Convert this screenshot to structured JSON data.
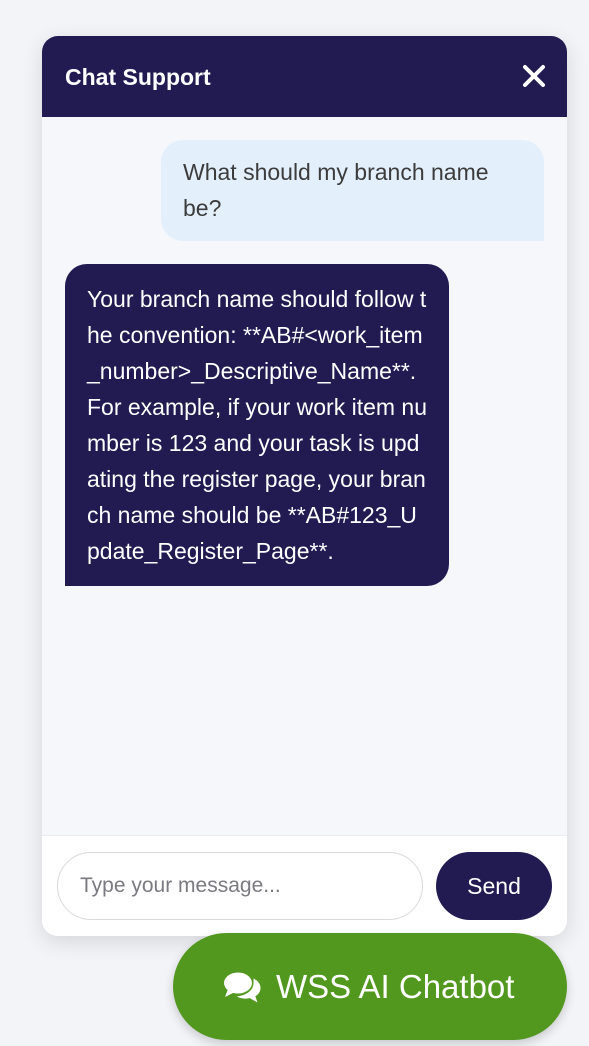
{
  "header": {
    "title": "Chat Support",
    "close_icon": "close-icon"
  },
  "messages": [
    {
      "role": "user",
      "text": "What should my branch name be?"
    },
    {
      "role": "bot",
      "text": "Your branch name should follow the convention: **AB#<work_item_number>_Descriptive_Name**. For example, if your work item number is 123 and your task is updating the register page, your branch name should be **AB#123_Update_Register_Page**."
    }
  ],
  "composer": {
    "placeholder": "Type your message...",
    "value": "",
    "send_label": "Send"
  },
  "launcher": {
    "label": "WSS AI Chatbot",
    "icon": "comments-icon"
  },
  "colors": {
    "brand_dark": "#221b52",
    "launcher_green": "#52981f",
    "user_bubble": "#e3f0fc",
    "chat_background": "#f6f7fa"
  }
}
